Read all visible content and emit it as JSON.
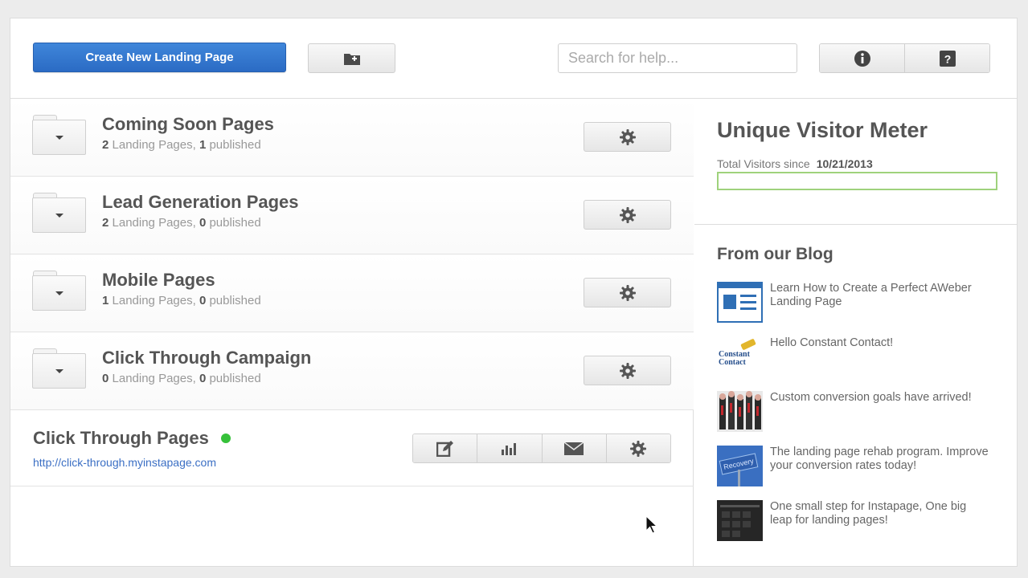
{
  "toolbar": {
    "create_label": "Create New Landing Page",
    "search_placeholder": "Search for help..."
  },
  "groups": [
    {
      "title": "Coming Soon Pages",
      "count": "2",
      "count_label": "Landing Pages,",
      "published": "1",
      "published_label": "published"
    },
    {
      "title": "Lead Generation Pages",
      "count": "2",
      "count_label": "Landing Pages,",
      "published": "0",
      "published_label": "published"
    },
    {
      "title": "Mobile Pages",
      "count": "1",
      "count_label": "Landing Pages,",
      "published": "0",
      "published_label": "published"
    },
    {
      "title": "Click Through Campaign",
      "count": "0",
      "count_label": "Landing Pages,",
      "published": "0",
      "published_label": "published"
    }
  ],
  "click_through": {
    "title": "Click Through Pages",
    "status_color": "#36c13a",
    "url": "http://click-through.myinstapage.com"
  },
  "meter": {
    "title": "Unique Visitor Meter",
    "since_label": "Total Visitors since",
    "since_date": "10/21/2013",
    "fill_fraction": 0
  },
  "blog": {
    "title": "From our Blog",
    "items": [
      {
        "text": "Learn How to Create a Perfect AWeber Landing Page"
      },
      {
        "text": "Hello Constant Contact!",
        "logo_text": "Constant Contact"
      },
      {
        "text": "Custom conversion goals have arrived!"
      },
      {
        "text": "The landing page rehab program. Improve your conversion rates today!",
        "sign_text": "Recovery"
      },
      {
        "text": "One small step for Instapage, One big leap for landing pages!"
      }
    ]
  },
  "colors": {
    "accent": "#2b6bc4",
    "link": "#3b6fc4",
    "meter": "#9fd27c"
  },
  "icons": [
    "add-folder-icon",
    "info-icon",
    "help-icon",
    "gear-icon",
    "edit-icon",
    "stats-icon",
    "mail-icon",
    "caret-down-icon"
  ]
}
